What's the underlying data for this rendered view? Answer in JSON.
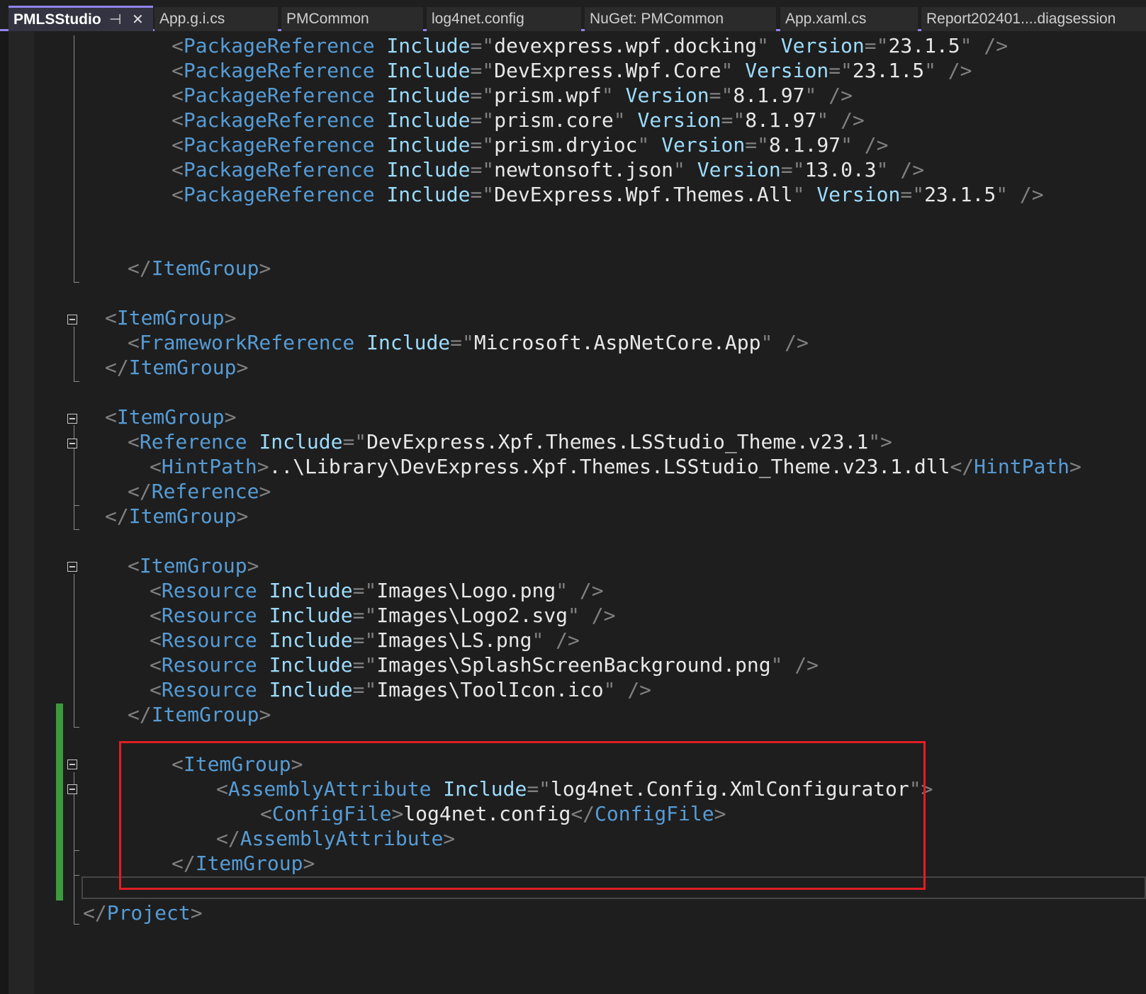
{
  "tabs": [
    {
      "label": "PMLSStudio",
      "active": true
    },
    {
      "label": "App.g.i.cs",
      "active": false
    },
    {
      "label": "PMCommon",
      "active": false
    },
    {
      "label": "log4net.config",
      "active": false
    },
    {
      "label": "NuGet: PMCommon",
      "active": false
    },
    {
      "label": "App.xaml.cs",
      "active": false
    },
    {
      "label": "Report202401....diagsession",
      "active": false
    }
  ],
  "icons": {
    "pin": "pin-icon",
    "close": "close-icon"
  },
  "colors": {
    "background": "#1e1e1e",
    "tag": "#569cd6",
    "attribute": "#9cdcfe",
    "delimiter": "#808080",
    "text": "#e8e8e8",
    "accent": "#9184ee",
    "highlight_box": "#e01e25",
    "change_bar": "#3c9a3c"
  },
  "code": {
    "pkg1": {
      "tag": "PackageReference",
      "attr1": "Include",
      "val1": "devexpress.wpf.docking",
      "attr2": "Version",
      "val2": "23.1.5"
    },
    "pkg2": {
      "tag": "PackageReference",
      "attr1": "Include",
      "val1": "DevExpress.Wpf.Core",
      "attr2": "Version",
      "val2": "23.1.5"
    },
    "pkg3": {
      "tag": "PackageReference",
      "attr1": "Include",
      "val1": "prism.wpf",
      "attr2": "Version",
      "val2": "8.1.97"
    },
    "pkg4": {
      "tag": "PackageReference",
      "attr1": "Include",
      "val1": "prism.core",
      "attr2": "Version",
      "val2": "8.1.97"
    },
    "pkg5": {
      "tag": "PackageReference",
      "attr1": "Include",
      "val1": "prism.dryioc",
      "attr2": "Version",
      "val2": "8.1.97"
    },
    "pkg6": {
      "tag": "PackageReference",
      "attr1": "Include",
      "val1": "newtonsoft.json",
      "attr2": "Version",
      "val2": "13.0.3"
    },
    "pkg7": {
      "tag": "PackageReference",
      "attr1": "Include",
      "val1": "DevExpress.Wpf.Themes.All",
      "attr2": "Version",
      "val2": "23.1.5"
    },
    "itemgroup_tag": "ItemGroup",
    "framework": {
      "tag": "FrameworkReference",
      "attr1": "Include",
      "val1": "Microsoft.AspNetCore.App"
    },
    "reference": {
      "tag": "Reference",
      "attr1": "Include",
      "val1": "DevExpress.Xpf.Themes.LSStudio_Theme.v23.1"
    },
    "hintpath": {
      "tag": "HintPath",
      "text": "..\\Library\\DevExpress.Xpf.Themes.LSStudio_Theme.v23.1.dll"
    },
    "res1": {
      "tag": "Resource",
      "attr1": "Include",
      "val1": "Images\\Logo.png"
    },
    "res2": {
      "tag": "Resource",
      "attr1": "Include",
      "val1": "Images\\Logo2.svg"
    },
    "res3": {
      "tag": "Resource",
      "attr1": "Include",
      "val1": "Images\\LS.png"
    },
    "res4": {
      "tag": "Resource",
      "attr1": "Include",
      "val1": "Images\\SplashScreenBackground.png"
    },
    "res5": {
      "tag": "Resource",
      "attr1": "Include",
      "val1": "Images\\ToolIcon.ico"
    },
    "assembly": {
      "tag": "AssemblyAttribute",
      "attr1": "Include",
      "val1": "log4net.Config.XmlConfigurator"
    },
    "configfile": {
      "tag": "ConfigFile",
      "text": "log4net.config"
    },
    "project_tag": "Project"
  }
}
